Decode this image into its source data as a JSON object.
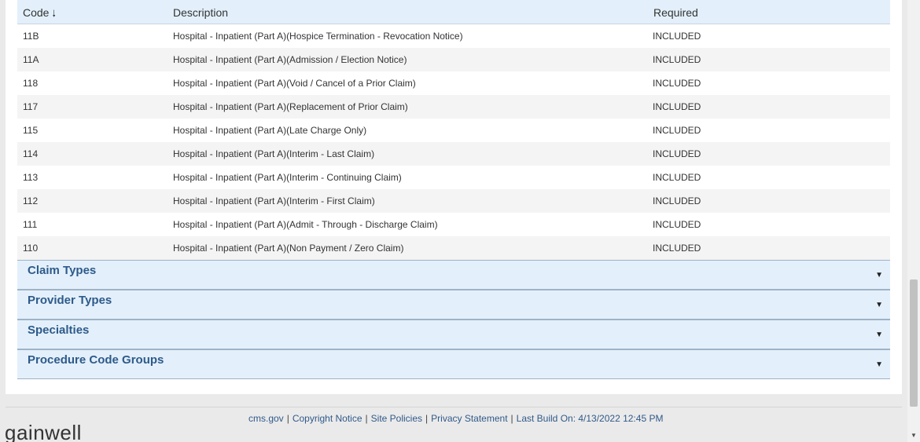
{
  "table": {
    "headers": {
      "code": "Code",
      "description": "Description",
      "required": "Required"
    },
    "sort_icon": "arrow-down-icon",
    "rows": [
      {
        "code": "11B",
        "description": "Hospital - Inpatient (Part A)(Hospice Termination - Revocation Notice)",
        "required": "INCLUDED"
      },
      {
        "code": "11A",
        "description": "Hospital - Inpatient (Part A)(Admission / Election Notice)",
        "required": "INCLUDED"
      },
      {
        "code": "118",
        "description": "Hospital - Inpatient (Part A)(Void / Cancel of a Prior Claim)",
        "required": "INCLUDED"
      },
      {
        "code": "117",
        "description": "Hospital - Inpatient (Part A)(Replacement of Prior Claim)",
        "required": "INCLUDED"
      },
      {
        "code": "115",
        "description": "Hospital - Inpatient (Part A)(Late Charge Only)",
        "required": "INCLUDED"
      },
      {
        "code": "114",
        "description": "Hospital - Inpatient (Part A)(Interim - Last Claim)",
        "required": "INCLUDED"
      },
      {
        "code": "113",
        "description": "Hospital - Inpatient (Part A)(Interim - Continuing Claim)",
        "required": "INCLUDED"
      },
      {
        "code": "112",
        "description": "Hospital - Inpatient (Part A)(Interim - First Claim)",
        "required": "INCLUDED"
      },
      {
        "code": "111",
        "description": "Hospital - Inpatient (Part A)(Admit - Through - Discharge Claim)",
        "required": "INCLUDED"
      },
      {
        "code": "110",
        "description": "Hospital - Inpatient (Part A)(Non Payment / Zero Claim)",
        "required": "INCLUDED"
      }
    ]
  },
  "accordions": [
    {
      "title": "Claim Types"
    },
    {
      "title": "Provider Types"
    },
    {
      "title": "Specialties"
    },
    {
      "title": "Procedure Code Groups"
    }
  ],
  "footer": {
    "links": [
      "cms.gov",
      "Copyright Notice",
      "Site Policies",
      "Privacy Statement"
    ],
    "separator": "|",
    "build_info": "Last Build On: 4/13/2022 12:45 PM",
    "logo_text": "gainwell"
  }
}
